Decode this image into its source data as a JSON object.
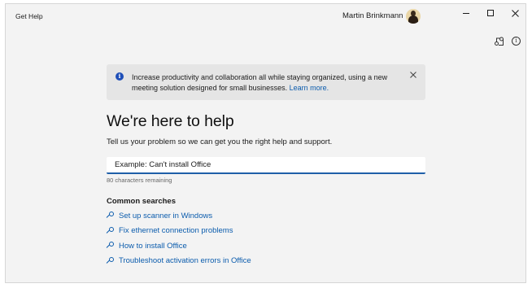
{
  "titlebar": {
    "app_title": "Get Help",
    "user_name": "Martin Brinkmann"
  },
  "banner": {
    "text": "Increase productivity and collaboration all while staying organized, using a new meeting solution designed for small businesses.",
    "link": "Learn more."
  },
  "main": {
    "heading": "We're here to help",
    "subheading": "Tell us your problem so we can get you the right help and support.",
    "search_placeholder": "Example: Can't install Office",
    "char_count": "80 characters remaining",
    "common_title": "Common searches",
    "common_searches": [
      "Set up scanner in Windows",
      "Fix ethernet connection problems",
      "How to install Office",
      "Troubleshoot activation errors in Office"
    ]
  },
  "colors": {
    "accent": "#1f5fa8",
    "link": "#0b5cad",
    "info": "#1f4fb8"
  }
}
